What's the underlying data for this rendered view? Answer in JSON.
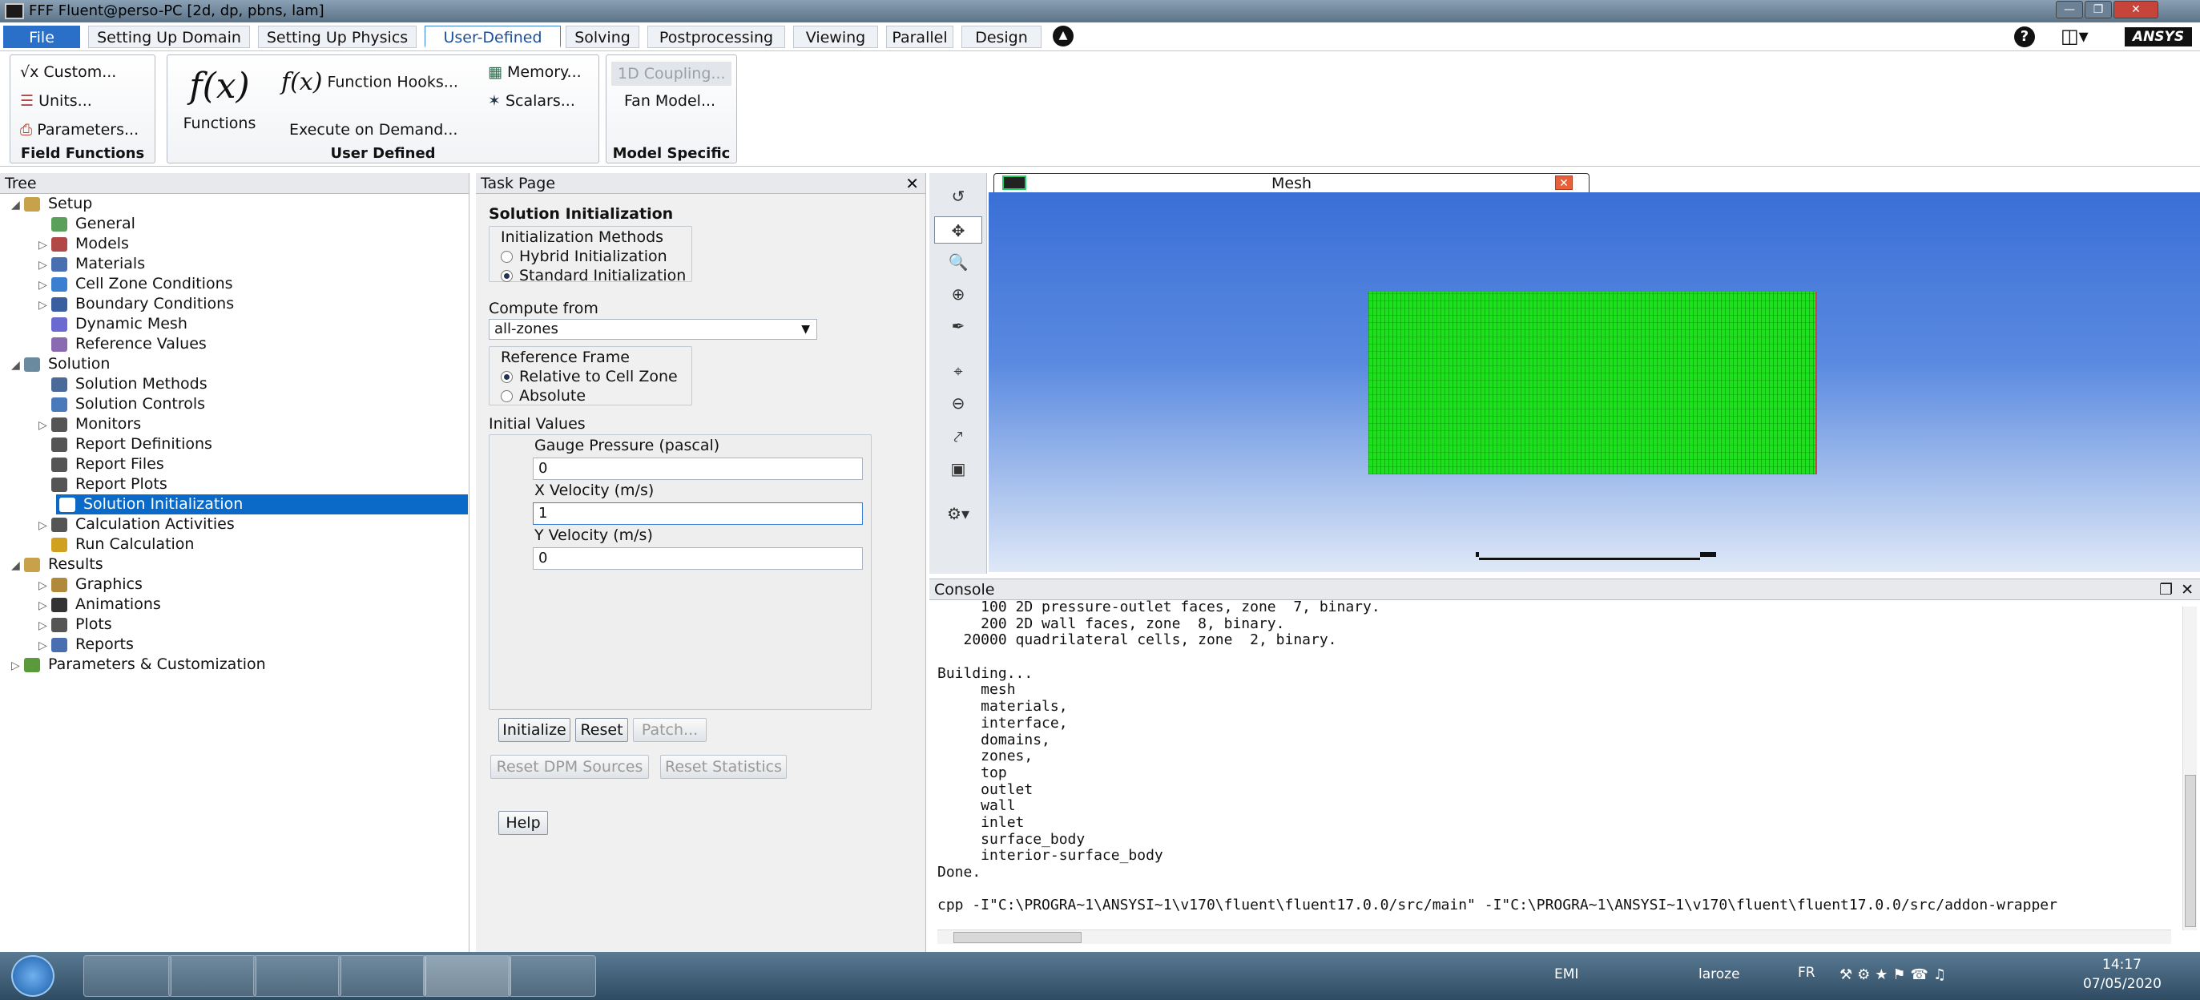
{
  "window": {
    "title": "FFF Fluent@perso-PC  [2d, dp, pbns, lam]"
  },
  "menu": [
    {
      "label": "File",
      "active": false,
      "file": true
    },
    {
      "label": "Setting Up Domain"
    },
    {
      "label": "Setting Up Physics"
    },
    {
      "label": "User-Defined",
      "active": true
    },
    {
      "label": "Solving"
    },
    {
      "label": "Postprocessing"
    },
    {
      "label": "Viewing"
    },
    {
      "label": "Parallel"
    },
    {
      "label": "Design"
    }
  ],
  "brand": "ANSYS",
  "ribbon": {
    "field_functions": {
      "label": "Field Functions",
      "custom": "Custom...",
      "units": "Units...",
      "parameters": "Parameters..."
    },
    "user_defined": {
      "label": "User Defined",
      "functions": "Functions",
      "function_hooks": "Function Hooks...",
      "execute_on_demand": "Execute on Demand...",
      "memory": "Memory...",
      "scalars": "Scalars...",
      "fx": "f(x)"
    },
    "model_specific": {
      "label": "Model Specific",
      "coupling": "1D Coupling...",
      "fan_model": "Fan Model..."
    }
  },
  "tree": {
    "header": "Tree",
    "items": [
      {
        "label": "Setup",
        "level": 0,
        "expand": "open",
        "icon": "setup-icon",
        "color": "#c8a24a"
      },
      {
        "label": "General",
        "level": 1,
        "expand": "",
        "icon": "general-icon",
        "color": "#5aa05a"
      },
      {
        "label": "Models",
        "level": 1,
        "expand": "closed",
        "icon": "models-icon",
        "color": "#b04848"
      },
      {
        "label": "Materials",
        "level": 1,
        "expand": "closed",
        "icon": "materials-icon",
        "color": "#4a6fb0"
      },
      {
        "label": "Cell Zone Conditions",
        "level": 1,
        "expand": "closed",
        "icon": "cell-zone-icon",
        "color": "#3a7fd0"
      },
      {
        "label": "Boundary Conditions",
        "level": 1,
        "expand": "closed",
        "icon": "boundary-icon",
        "color": "#3a5fa0"
      },
      {
        "label": "Dynamic Mesh",
        "level": 1,
        "expand": "",
        "icon": "dynamic-mesh-icon",
        "color": "#6a6ad0"
      },
      {
        "label": "Reference Values",
        "level": 1,
        "expand": "",
        "icon": "reference-icon",
        "color": "#8a6ab0"
      },
      {
        "label": "Solution",
        "level": 0,
        "expand": "open",
        "icon": "solution-icon",
        "color": "#6a8aa0"
      },
      {
        "label": "Solution Methods",
        "level": 1,
        "expand": "",
        "icon": "methods-icon",
        "color": "#4a6a9a"
      },
      {
        "label": "Solution Controls",
        "level": 1,
        "expand": "",
        "icon": "controls-icon",
        "color": "#4a7aba"
      },
      {
        "label": "Monitors",
        "level": 1,
        "expand": "closed",
        "icon": "monitors-icon",
        "color": "#555"
      },
      {
        "label": "Report Definitions",
        "level": 1,
        "expand": "",
        "icon": "report-def-icon",
        "color": "#555"
      },
      {
        "label": "Report Files",
        "level": 1,
        "expand": "",
        "icon": "report-files-icon",
        "color": "#555"
      },
      {
        "label": "Report Plots",
        "level": 1,
        "expand": "",
        "icon": "report-plots-icon",
        "color": "#555"
      },
      {
        "label": "Solution Initialization",
        "level": 1,
        "expand": "",
        "icon": "initialization-icon",
        "color": "#3a5fa0",
        "selected": true
      },
      {
        "label": "Calculation Activities",
        "level": 1,
        "expand": "closed",
        "icon": "calc-activities-icon",
        "color": "#555"
      },
      {
        "label": "Run Calculation",
        "level": 1,
        "expand": "",
        "icon": "run-icon",
        "color": "#d0a020"
      },
      {
        "label": "Results",
        "level": 0,
        "expand": "open",
        "icon": "results-icon",
        "color": "#c8a24a"
      },
      {
        "label": "Graphics",
        "level": 1,
        "expand": "closed",
        "icon": "graphics-icon",
        "color": "#b08a3a"
      },
      {
        "label": "Animations",
        "level": 1,
        "expand": "closed",
        "icon": "animations-icon",
        "color": "#333"
      },
      {
        "label": "Plots",
        "level": 1,
        "expand": "closed",
        "icon": "plots-icon",
        "color": "#555"
      },
      {
        "label": "Reports",
        "level": 1,
        "expand": "closed",
        "icon": "reports-icon",
        "color": "#4a6fb0"
      },
      {
        "label": "Parameters & Customization",
        "level": 0,
        "expand": "closed",
        "icon": "parameters-icon",
        "color": "#5a9a3a"
      }
    ]
  },
  "task": {
    "header": "Task Page",
    "title": "Solution Initialization",
    "init_methods": {
      "legend": "Initialization Methods",
      "options": [
        "Hybrid  Initialization",
        "Standard Initialization"
      ],
      "selected": 1
    },
    "compute_from": {
      "label": "Compute from",
      "value": "all-zones"
    },
    "ref_frame": {
      "legend": "Reference Frame",
      "options": [
        "Relative to Cell Zone",
        "Absolute"
      ],
      "selected": 0
    },
    "initial_values": {
      "label": "Initial Values",
      "fields": [
        {
          "label": "Gauge Pressure (pascal)",
          "value": "0"
        },
        {
          "label": "X Velocity (m/s)",
          "value": "1"
        },
        {
          "label": "Y Velocity (m/s)",
          "value": "0"
        }
      ]
    },
    "buttons": {
      "initialize": "Initialize",
      "reset": "Reset",
      "patch": "Patch...",
      "reset_dpm": "Reset DPM Sources",
      "reset_stats": "Reset Statistics",
      "help": "Help"
    }
  },
  "graphics": {
    "tab": "Mesh",
    "mesh_color": "#1ee01e"
  },
  "console": {
    "header": "Console",
    "lines": [
      "     100 2D pressure-outlet faces, zone  7, binary.",
      "     200 2D wall faces, zone  8, binary.",
      "   20000 quadrilateral cells, zone  2, binary.",
      "",
      "Building...",
      "     mesh",
      "     materials,",
      "     interface,",
      "     domains,",
      "     zones,",
      "     top",
      "     outlet",
      "     wall",
      "     inlet",
      "     surface_body",
      "     interior-surface_body",
      "Done.",
      "",
      "cpp -I\"C:\\PROGRA~1\\ANSYSI~1\\v170\\fluent\\fluent17.0.0/src/main\" -I\"C:\\PROGRA~1\\ANSYSI~1\\v170\\fluent\\fluent17.0.0/src/addon-wrapper"
    ]
  },
  "taskbar": {
    "tray_label_1": "EMI",
    "tray_label_2": "laroze",
    "lang": "FR",
    "time": "14:17",
    "date": "07/05/2020"
  }
}
